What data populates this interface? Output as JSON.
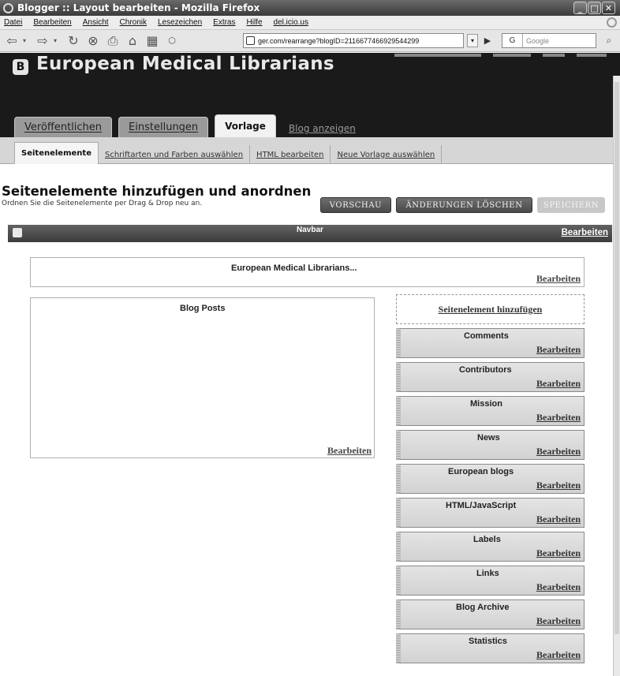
{
  "window": {
    "title": "Blogger :: Layout bearbeiten - Mozilla Firefox"
  },
  "menu": {
    "items": [
      "Datei",
      "Bearbeiten",
      "Ansicht",
      "Chronik",
      "Lesezeichen",
      "Extras",
      "Hilfe",
      "del.icio.us"
    ]
  },
  "toolbar": {
    "url": "ger.com/rearrange?blogID=2116677466929544299",
    "search_placeholder": "Google",
    "search_engine": "G"
  },
  "blog": {
    "logo": "B",
    "title": "European Medical Librarians"
  },
  "tabs": [
    {
      "label": "Veröffentlichen"
    },
    {
      "label": "Einstellungen"
    },
    {
      "label": "Vorlage"
    }
  ],
  "view_blog": "Blog anzeigen",
  "subtabs": [
    {
      "label": "Seitenelemente"
    },
    {
      "label": "Schriftarten und Farben auswählen"
    },
    {
      "label": "HTML bearbeiten"
    },
    {
      "label": "Neue Vorlage auswählen"
    }
  ],
  "page": {
    "title": "Seitenelemente hinzufügen und anordnen",
    "subtitle": "Ordnen Sie die Seitenelemente per Drag & Drop neu an."
  },
  "buttons": {
    "preview": "VORSCHAU",
    "discard": "ÄNDERUNGEN LÖSCHEN",
    "save": "SPEICHERN"
  },
  "navbar_strip": {
    "label": "Navbar",
    "edit": "Bearbeiten"
  },
  "header_element": {
    "name": "European Medical Librarians...",
    "edit": "Bearbeiten"
  },
  "blog_posts": {
    "name": "Blog Posts",
    "edit": "Bearbeiten"
  },
  "add_element": "Seitenelement hinzufügen",
  "gadgets": [
    {
      "name": "Comments",
      "edit": "Bearbeiten"
    },
    {
      "name": "Contributors",
      "edit": "Bearbeiten"
    },
    {
      "name": "Mission",
      "edit": "Bearbeiten"
    },
    {
      "name": "News",
      "edit": "Bearbeiten"
    },
    {
      "name": "European blogs",
      "edit": "Bearbeiten"
    },
    {
      "name": "HTML/JavaScript",
      "edit": "Bearbeiten"
    },
    {
      "name": "Labels",
      "edit": "Bearbeiten"
    },
    {
      "name": "Links",
      "edit": "Bearbeiten"
    },
    {
      "name": "Blog Archive",
      "edit": "Bearbeiten"
    },
    {
      "name": "Statistics",
      "edit": "Bearbeiten"
    }
  ]
}
